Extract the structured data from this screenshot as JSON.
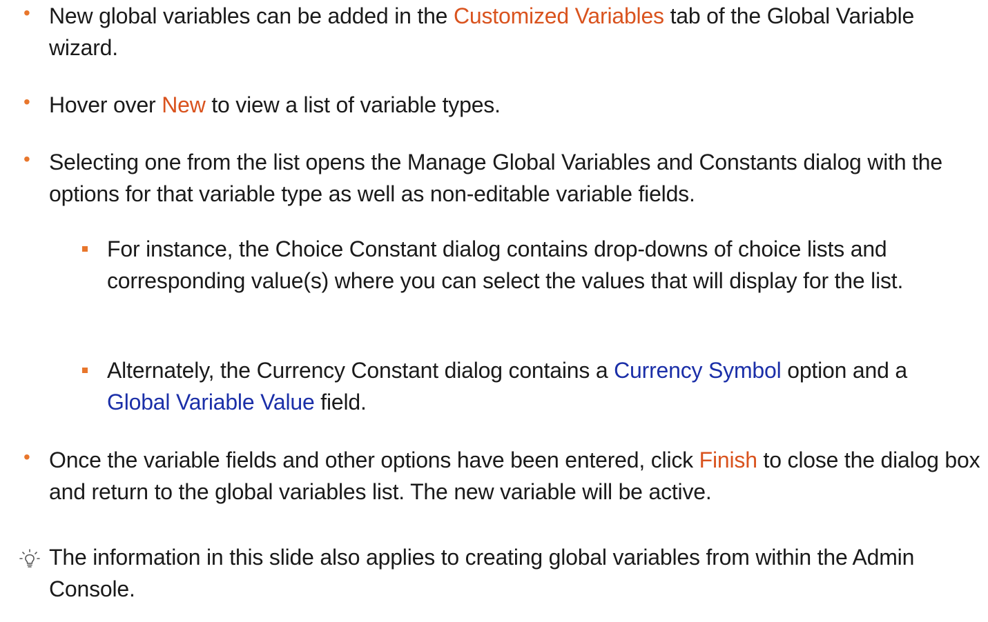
{
  "bullets": [
    {
      "p1": "New global variables can be added in the ",
      "hl": "Customized Variables",
      "p2": " tab of the Global Variable wizard."
    },
    {
      "p1": "Hover over ",
      "hl": "New",
      "p2": " to view a list of variable types."
    },
    {
      "text": "Selecting one from the list opens the Manage Global Variables and Constants dialog with the options for that variable type as well as non-editable variable fields."
    }
  ],
  "sub_bullets": [
    {
      "text": "For instance, the Choice Constant dialog contains drop-downs of choice lists and corresponding value(s) where you can select the values that will display for the list."
    },
    {
      "p1": "Alternately, the Currency Constant dialog contains a ",
      "hl1": "Currency Symbol",
      "p2": " option and a ",
      "hl2": "Global Variable Value",
      "p3": " field."
    }
  ],
  "final_bullet": {
    "p1": "Once the variable fields and other options have been entered, click ",
    "hl": "Finish",
    "p2": " to close the dialog box and return to the global variables list. The new variable will be active."
  },
  "tip": {
    "icon": "lightbulb-icon",
    "text": "The information in this slide also applies to creating global variables from within the Admin Console."
  },
  "colors": {
    "bullet": "#E8762C",
    "highlight_orange": "#D9531E",
    "highlight_blue": "#1B2FA8",
    "text": "#1a1a1a"
  }
}
